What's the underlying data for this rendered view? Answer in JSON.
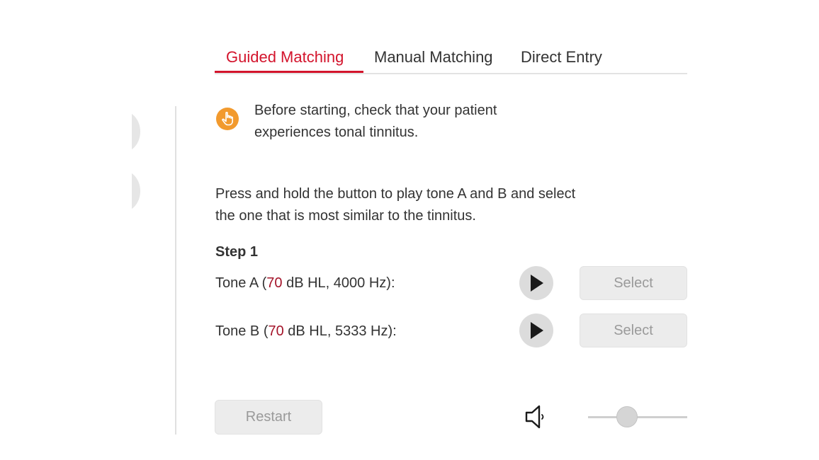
{
  "tabs": [
    {
      "label": "Guided Matching",
      "active": true
    },
    {
      "label": "Manual Matching",
      "active": false
    },
    {
      "label": "Direct Entry",
      "active": false
    }
  ],
  "info": {
    "icon": "hand-pointer-icon",
    "line1": "Before starting, check that your patient",
    "line2": "experiences tonal tinnitus."
  },
  "instructions": {
    "line1": "Press and hold the button to play tone A and B and select",
    "line2": "the one that is most similar to the tinnitus."
  },
  "step": {
    "title": "Step 1"
  },
  "tones": [
    {
      "prefix": "Tone A (",
      "level": "70",
      "suffix": " dB HL, 4000 Hz):",
      "select_label": "Select"
    },
    {
      "prefix": "Tone B (",
      "level": "70",
      "suffix": " dB HL, 5333 Hz):",
      "select_label": "Select"
    }
  ],
  "restart_label": "Restart",
  "volume": {
    "icon": "speaker-icon",
    "level": 0.36
  },
  "colors": {
    "accent": "#d3142c",
    "info_icon": "#f29a2e",
    "level_text": "#a4142a"
  }
}
